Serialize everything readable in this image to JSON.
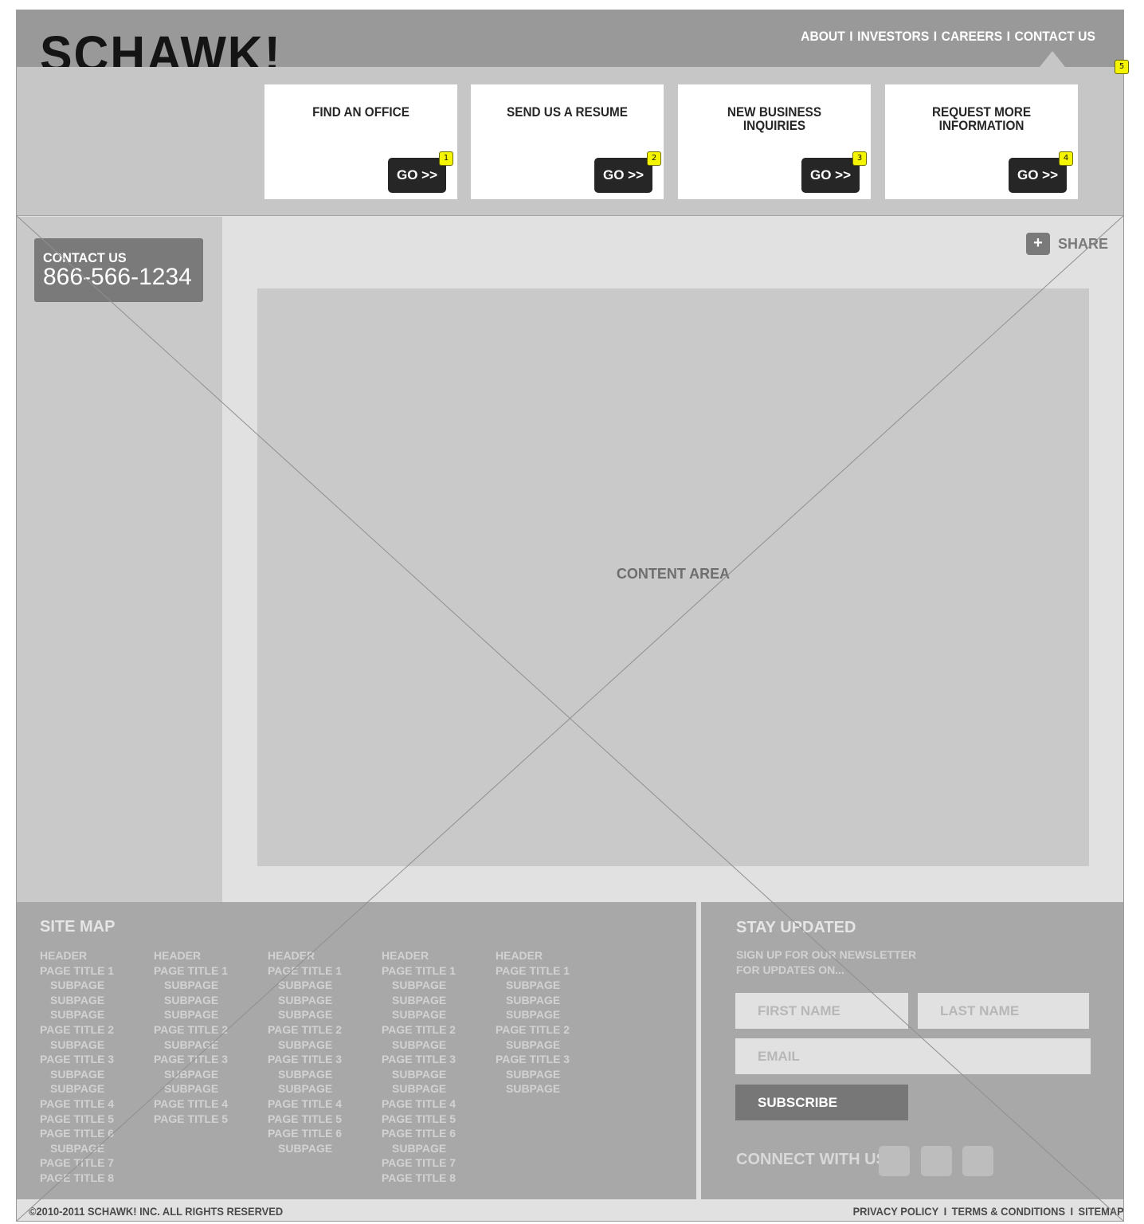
{
  "header": {
    "logo": "SCHAWK!",
    "nav": [
      "ABOUT",
      "INVESTORS",
      "CAREERS",
      "CONTACT US"
    ],
    "nav_separator": "I",
    "badge": "5"
  },
  "cta": [
    {
      "title": "FIND AN OFFICE",
      "button": "GO >>",
      "badge": "1"
    },
    {
      "title": "SEND US A RESUME",
      "button": "GO >>",
      "badge": "2"
    },
    {
      "title": "NEW BUSINESS\nINQUIRIES",
      "button": "GO >>",
      "badge": "3"
    },
    {
      "title": "REQUEST MORE\nINFORMATION",
      "button": "GO >>",
      "badge": "4"
    }
  ],
  "contact": {
    "label": "CONTACT US",
    "phone": "866-566-1234"
  },
  "share": {
    "icon": "+",
    "label": "SHARE"
  },
  "content": {
    "label": "CONTENT AREA"
  },
  "sitemap": {
    "title": "SITE MAP",
    "columns": [
      [
        {
          "text": "HEADER",
          "sub": false
        },
        {
          "text": "PAGE TITLE 1",
          "sub": false
        },
        {
          "text": "SUBPAGE",
          "sub": true
        },
        {
          "text": "SUBPAGE",
          "sub": true
        },
        {
          "text": "SUBPAGE",
          "sub": true
        },
        {
          "text": "PAGE TITLE 2",
          "sub": false
        },
        {
          "text": "SUBPAGE",
          "sub": true
        },
        {
          "text": "PAGE TITLE 3",
          "sub": false
        },
        {
          "text": "SUBPAGE",
          "sub": true
        },
        {
          "text": "SUBPAGE",
          "sub": true
        },
        {
          "text": "PAGE TITLE 4",
          "sub": false
        },
        {
          "text": "PAGE TITLE 5",
          "sub": false
        },
        {
          "text": "PAGE TITLE 6",
          "sub": false
        },
        {
          "text": "SUBPAGE",
          "sub": true
        },
        {
          "text": "PAGE TITLE 7",
          "sub": false
        },
        {
          "text": "PAGE TITLE 8",
          "sub": false
        }
      ],
      [
        {
          "text": "HEADER",
          "sub": false
        },
        {
          "text": "PAGE TITLE 1",
          "sub": false
        },
        {
          "text": "SUBPAGE",
          "sub": true
        },
        {
          "text": "SUBPAGE",
          "sub": true
        },
        {
          "text": "SUBPAGE",
          "sub": true
        },
        {
          "text": "PAGE TITLE 2",
          "sub": false
        },
        {
          "text": "SUBPAGE",
          "sub": true
        },
        {
          "text": "PAGE TITLE 3",
          "sub": false
        },
        {
          "text": "SUBPAGE",
          "sub": true
        },
        {
          "text": "SUBPAGE",
          "sub": true
        },
        {
          "text": "PAGE TITLE 4",
          "sub": false
        },
        {
          "text": "PAGE TITLE 5",
          "sub": false
        }
      ],
      [
        {
          "text": "HEADER",
          "sub": false
        },
        {
          "text": "PAGE TITLE 1",
          "sub": false
        },
        {
          "text": "SUBPAGE",
          "sub": true
        },
        {
          "text": "SUBPAGE",
          "sub": true
        },
        {
          "text": "SUBPAGE",
          "sub": true
        },
        {
          "text": "PAGE TITLE 2",
          "sub": false
        },
        {
          "text": "SUBPAGE",
          "sub": true
        },
        {
          "text": "PAGE TITLE 3",
          "sub": false
        },
        {
          "text": "SUBPAGE",
          "sub": true
        },
        {
          "text": "SUBPAGE",
          "sub": true
        },
        {
          "text": "PAGE TITLE 4",
          "sub": false
        },
        {
          "text": "PAGE TITLE 5",
          "sub": false
        },
        {
          "text": "PAGE TITLE 6",
          "sub": false
        },
        {
          "text": "SUBPAGE",
          "sub": true
        }
      ],
      [
        {
          "text": "HEADER",
          "sub": false
        },
        {
          "text": "PAGE TITLE 1",
          "sub": false
        },
        {
          "text": "SUBPAGE",
          "sub": true
        },
        {
          "text": "SUBPAGE",
          "sub": true
        },
        {
          "text": "SUBPAGE",
          "sub": true
        },
        {
          "text": "PAGE TITLE 2",
          "sub": false
        },
        {
          "text": "SUBPAGE",
          "sub": true
        },
        {
          "text": "PAGE TITLE 3",
          "sub": false
        },
        {
          "text": "SUBPAGE",
          "sub": true
        },
        {
          "text": "SUBPAGE",
          "sub": true
        },
        {
          "text": "PAGE TITLE 4",
          "sub": false
        },
        {
          "text": "PAGE TITLE 5",
          "sub": false
        },
        {
          "text": "PAGE TITLE 6",
          "sub": false
        },
        {
          "text": "SUBPAGE",
          "sub": true
        },
        {
          "text": "PAGE TITLE 7",
          "sub": false
        },
        {
          "text": "PAGE TITLE 8",
          "sub": false
        }
      ],
      [
        {
          "text": "HEADER",
          "sub": false
        },
        {
          "text": "PAGE TITLE 1",
          "sub": false
        },
        {
          "text": "SUBPAGE",
          "sub": true
        },
        {
          "text": "SUBPAGE",
          "sub": true
        },
        {
          "text": "SUBPAGE",
          "sub": true
        },
        {
          "text": "PAGE TITLE 2",
          "sub": false
        },
        {
          "text": "SUBPAGE",
          "sub": true
        },
        {
          "text": "PAGE TITLE 3",
          "sub": false
        },
        {
          "text": "SUBPAGE",
          "sub": true
        },
        {
          "text": "SUBPAGE",
          "sub": true
        }
      ]
    ]
  },
  "newsletter": {
    "title": "STAY UPDATED",
    "intro_line1": "SIGN UP FOR OUR NEWSLETTER",
    "intro_line2": "FOR UPDATES ON...",
    "first_name_placeholder": "FIRST NAME",
    "last_name_placeholder": "LAST NAME",
    "email_placeholder": "EMAIL",
    "subscribe_label": "SUBSCRIBE",
    "connect_label": "CONNECT WITH US"
  },
  "footer": {
    "copyright": "©2010-2011 SCHAWK! INC. ALL RIGHTS RESERVED",
    "links": [
      "PRIVACY POLICY",
      "TERMS & CONDITIONS",
      "SITEMAP"
    ],
    "separator": "I"
  },
  "colors": {
    "header_bg": "#999999",
    "cta_band_bg": "#c6c6c6",
    "button_dark": "#262626",
    "badge_yellow": "#f5f500",
    "footer_bg": "#a8a8a8"
  }
}
